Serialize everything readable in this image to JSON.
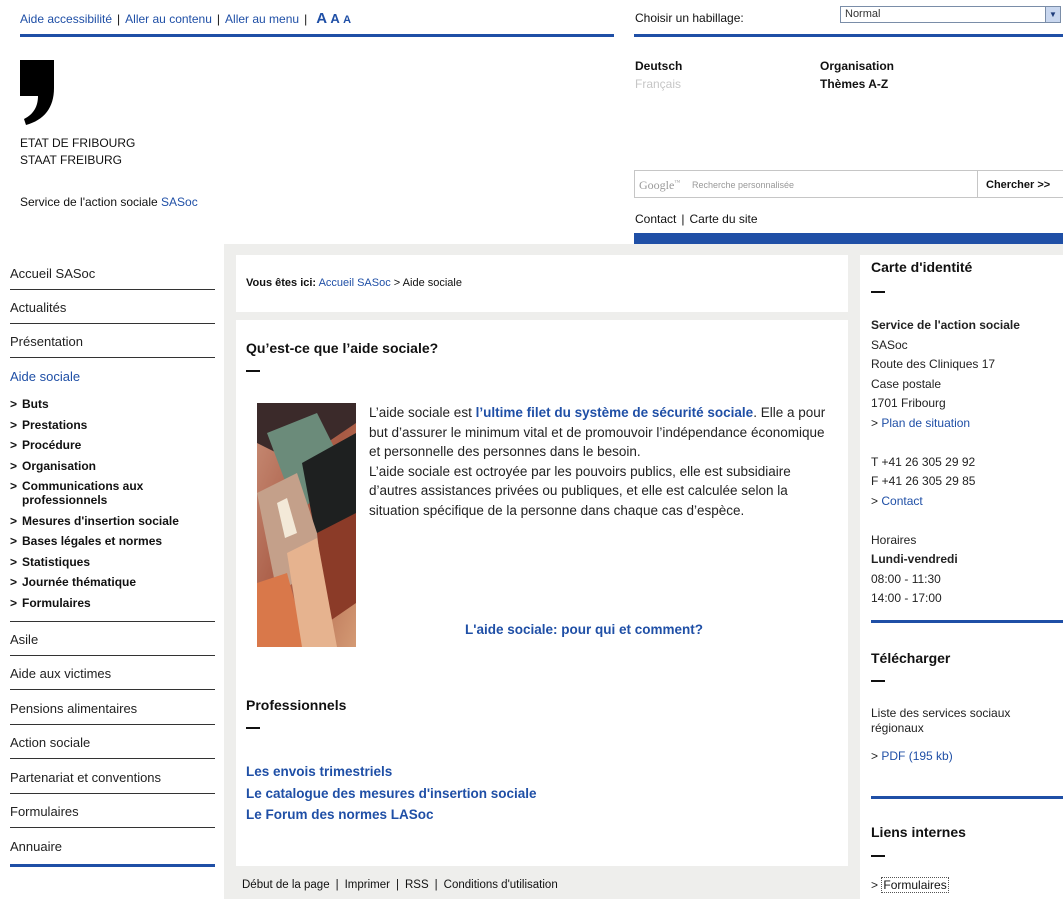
{
  "topbar": {
    "accessibility": "Aide accessibilité",
    "skip_content": "Aller au contenu",
    "skip_menu": "Aller au menu",
    "font_size_large": "A",
    "font_size_medium": "A",
    "font_size_small": "A",
    "skin_label": "Choisir un habillage:",
    "skin_value": "Normal"
  },
  "header": {
    "state_fr": "ETAT DE FRIBOURG",
    "state_de": "STAAT FREIBURG",
    "service_name": "Service de l'action sociale",
    "service_abbr": "SASoc",
    "lang_de": "Deutsch",
    "lang_fr": "Français",
    "link_org": "Organisation",
    "link_themes": "Thèmes A-Z",
    "search_brand": "Google",
    "search_brand_tm": "™",
    "search_placeholder": "Recherche personnalisée",
    "search_button": "Chercher >>",
    "link_contact": "Contact",
    "link_sitemap": "Carte du site"
  },
  "leftnav": {
    "items_top": [
      "Accueil SASoc",
      "Actualités",
      "Présentation"
    ],
    "active": "Aide sociale",
    "sub_items": [
      "Buts",
      "Prestations",
      "Procédure",
      "Organisation",
      "Communications aux professionnels",
      "Mesures d'insertion sociale",
      "Bases légales et normes",
      "Statistiques",
      "Journée thématique",
      "Formulaires"
    ],
    "items_bottom": [
      "Asile",
      "Aide aux victimes",
      "Pensions alimentaires",
      "Action sociale",
      "Partenariat et conventions",
      "Formulaires",
      "Annuaire"
    ]
  },
  "main": {
    "breadcrumb_label": "Vous êtes ici:",
    "breadcrumb_home": "Accueil SASoc",
    "breadcrumb_sep": ">",
    "breadcrumb_current": "Aide sociale",
    "title": "Qu’est-ce que l’aide sociale?",
    "p1_start": "L’aide sociale est ",
    "p1_highlight": "l’ultime filet du système de sécurité sociale",
    "p1_end": ". Elle a pour but d’assurer le minimum vital et de promouvoir l’indépendance économique et personnelle des personnes dans le besoin.",
    "p2": "L’aide sociale est octroyée par les pouvoirs publics, elle est subsidiaire d’autres assistances privées ou publiques, et elle est calculée selon la situation spécifique de la personne dans chaque cas d’espèce.",
    "center_link": "L'aide sociale: pour qui et comment?",
    "pro_title": "Professionnels",
    "pro_links": [
      "Les envois trimestriels",
      "Le catalogue des mesures d'insertion sociale",
      "Le Forum des normes LASoc"
    ]
  },
  "footer": {
    "top": "Début de la page",
    "print": "Imprimer",
    "rss": "RSS",
    "terms": "Conditions d'utilisation"
  },
  "right": {
    "id_title": "Carte d'identité",
    "id_name": "Service de l'action sociale",
    "id_abbr": "SASoc",
    "id_street": "Route des Cliniques 17",
    "id_box": "Case postale",
    "id_city": "1701 Fribourg",
    "id_map": "Plan de situation",
    "id_phone": "T +41 26 305 29 92",
    "id_fax": "F +41 26 305 29 85",
    "id_contact": "Contact",
    "hours_label": "Horaires",
    "hours_days": "Lundi-vendredi",
    "hours_am": "08:00 - 11:30",
    "hours_pm": "14:00 - 17:00",
    "dl_title": "Télécharger",
    "dl_desc": "Liste des services sociaux régionaux",
    "dl_link": "PDF (195 kb)",
    "links_title": "Liens internes",
    "links_first": "Formulaires"
  },
  "colors": {
    "brand_blue": "#1f4fa6",
    "grey_bg": "#eeeeec"
  }
}
